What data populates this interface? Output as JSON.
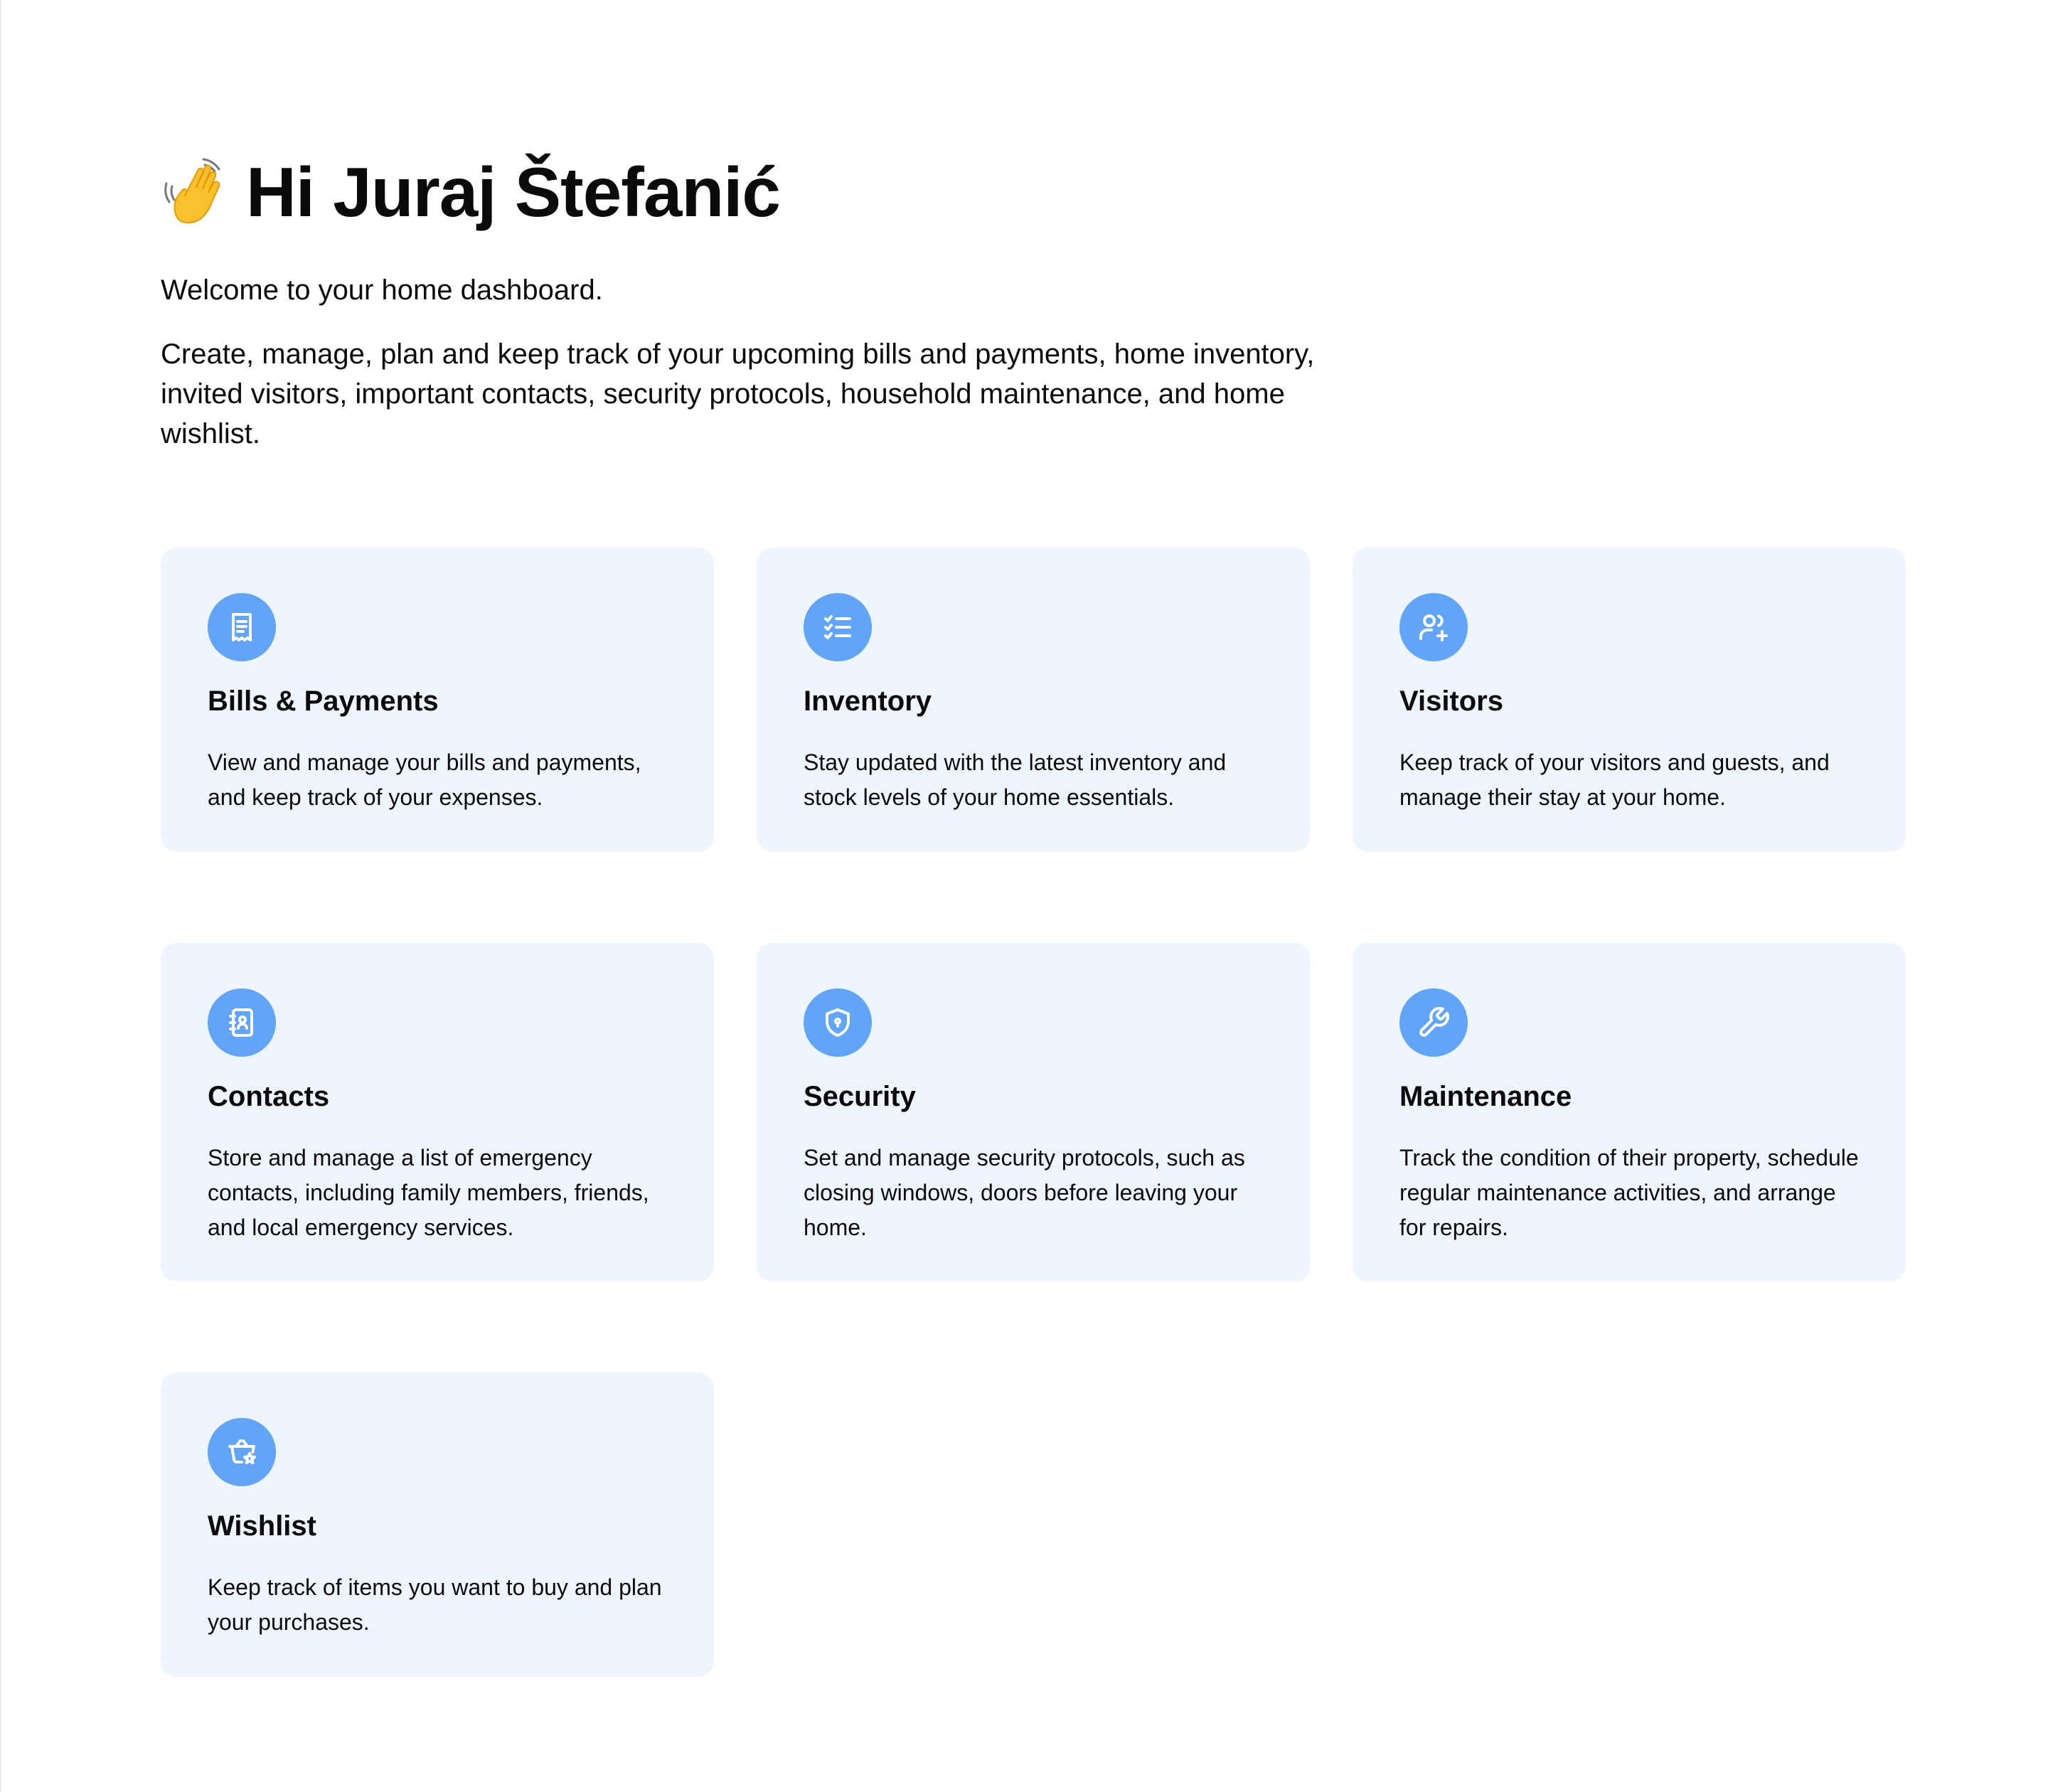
{
  "header": {
    "greeting": "Hi Juraj Štefanić",
    "welcome": "Welcome to your home dashboard.",
    "description": "Create, manage, plan and keep track of your upcoming bills and payments, home inventory, invited visitors, important contacts, security protocols, household maintenance, and home wishlist."
  },
  "cards": [
    {
      "title": "Bills & Payments",
      "description": "View and manage your bills and payments, and keep track of your expenses.",
      "icon": "receipt-icon"
    },
    {
      "title": "Inventory",
      "description": "Stay updated with the latest inventory and stock levels of your home essentials.",
      "icon": "checklist-icon"
    },
    {
      "title": "Visitors",
      "description": "Keep track of your visitors and guests, and manage their stay at your home.",
      "icon": "users-plus-icon"
    },
    {
      "title": "Contacts",
      "description": "Store and manage a list of emergency contacts, including family members, friends, and local emergency services.",
      "icon": "address-book-icon"
    },
    {
      "title": "Security",
      "description": "Set and manage security protocols, such as closing windows, doors before leaving your home.",
      "icon": "shield-lock-icon"
    },
    {
      "title": "Maintenance",
      "description": "Track the condition of their property, schedule regular maintenance activities, and arrange for repairs.",
      "icon": "wrench-icon"
    },
    {
      "title": "Wishlist",
      "description": "Keep track of items you want to buy and plan your purchases.",
      "icon": "basket-star-icon"
    }
  ],
  "colors": {
    "card_background": "#eff5fe",
    "icon_background": "#60a5fa",
    "text": "#0b0b0b"
  }
}
